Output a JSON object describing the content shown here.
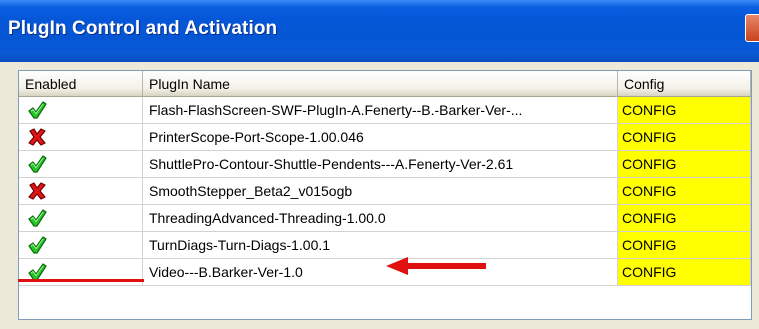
{
  "window": {
    "title": "PlugIn Control and Activation"
  },
  "table": {
    "columns": [
      "Enabled",
      "PlugIn Name",
      "Config"
    ],
    "rows": [
      {
        "enabled": true,
        "enabled_icon": "green-check-icon",
        "name": "Flash-FlashScreen-SWF-PlugIn-A.Fenerty--B.-Barker-Ver-...",
        "config": "CONFIG"
      },
      {
        "enabled": false,
        "enabled_icon": "red-x-icon",
        "name": "PrinterScope-Port-Scope-1.00.046",
        "config": "CONFIG"
      },
      {
        "enabled": true,
        "enabled_icon": "green-check-icon",
        "name": "ShuttlePro-Contour-Shuttle-Pendents---A.Fenerty-Ver-2.61",
        "config": "CONFIG"
      },
      {
        "enabled": false,
        "enabled_icon": "red-x-icon",
        "name": "SmoothStepper_Beta2_v015ogb",
        "config": "CONFIG"
      },
      {
        "enabled": true,
        "enabled_icon": "green-check-icon",
        "name": "ThreadingAdvanced-Threading-1.00.0",
        "config": "CONFIG"
      },
      {
        "enabled": true,
        "enabled_icon": "green-check-icon",
        "name": "TurnDiags-Turn-Diags-1.00.1",
        "config": "CONFIG"
      },
      {
        "enabled": true,
        "enabled_icon": "green-check-icon",
        "name": "Video---B.Barker-Ver-1.0",
        "config": "CONFIG"
      }
    ]
  },
  "annotations": {
    "color": "#e01010",
    "highlighted_row": 5
  },
  "colors": {
    "config_bg": "#ffff00",
    "titlebar": "#0556d4"
  }
}
